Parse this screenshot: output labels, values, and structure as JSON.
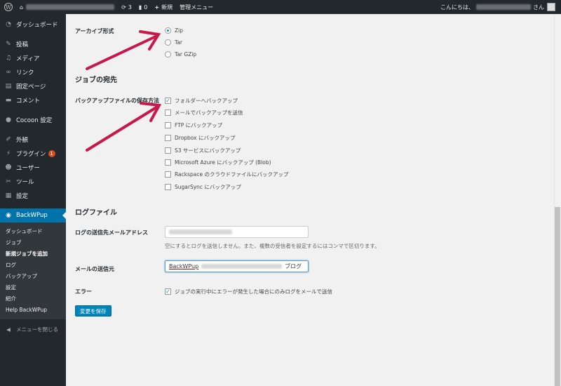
{
  "adminbar": {
    "updates_count": "3",
    "comments_count": "0",
    "new_label": "新規",
    "admin_menu_label": "管理メニュー",
    "greeting": "こんにちは、",
    "greeting_suffix": "さん"
  },
  "sidebar": {
    "items": [
      {
        "label": "ダッシュボード",
        "icon": "dashboard-icon"
      },
      {
        "label": "投稿",
        "icon": "pin-icon"
      },
      {
        "label": "メディア",
        "icon": "media-icon"
      },
      {
        "label": "リンク",
        "icon": "link-icon"
      },
      {
        "label": "固定ページ",
        "icon": "page-icon"
      },
      {
        "label": "コメント",
        "icon": "comment-icon"
      },
      {
        "label": "Cocoon 設定",
        "icon": "circle-icon"
      },
      {
        "label": "外観",
        "icon": "brush-icon"
      },
      {
        "label": "プラグイン",
        "icon": "plugin-icon",
        "badge": "1"
      },
      {
        "label": "ユーザー",
        "icon": "user-icon"
      },
      {
        "label": "ツール",
        "icon": "wrench-icon"
      },
      {
        "label": "設定",
        "icon": "settings-icon"
      },
      {
        "label": "BackWPup",
        "icon": "backwpup-icon"
      }
    ],
    "submenu": [
      "ダッシュボード",
      "ジョブ",
      "新規ジョブを追加",
      "ログ",
      "バックアップ",
      "設定",
      "紹介",
      "Help BackWPup"
    ],
    "collapse_label": "メニューを閉じる"
  },
  "form": {
    "archive_format_label": "アーカイブ形式",
    "archive_formats": [
      "Zip",
      "Tar",
      "Tar GZip"
    ],
    "archive_format_selected": "Zip",
    "job_destination_title": "ジョブの宛先",
    "backup_location_label": "バックアップファイルの保存方法",
    "destinations": [
      {
        "label": "フォルダーへバックアップ",
        "checked": true
      },
      {
        "label": "メールでバックアップを送信",
        "checked": false
      },
      {
        "label": "FTP にバックアップ",
        "checked": false
      },
      {
        "label": "Dropbox にバックアップ",
        "checked": false
      },
      {
        "label": "S3 サービスにバックアップ",
        "checked": false
      },
      {
        "label": "Microsoft Azure にバックアップ (Blob)",
        "checked": false
      },
      {
        "label": "Rackspace のクラウドファイルにバックアップ",
        "checked": false
      },
      {
        "label": "SugarSync にバックアップ",
        "checked": false
      }
    ],
    "log_file_title": "ログファイル",
    "log_email_label": "ログの送信先メールアドレス",
    "log_email_desc": "空にするとログを送信しません。また、複数の受信者を設定するにはコンマで区切ります。",
    "mail_sender_label": "メールの送信元",
    "mail_sender_value_prefix": "BackWPup",
    "mail_sender_value_suffix": "ブログ",
    "error_label": "エラー",
    "error_option": "ジョブの実行中にエラーが発生した場合にのみログをメールで送信",
    "error_checked": true,
    "save_button": "変更を保存"
  },
  "colors": {
    "adminbar_bg": "#23282d",
    "accent": "#0073aa",
    "button": "#0085ba",
    "arrow": "#c8174a"
  }
}
